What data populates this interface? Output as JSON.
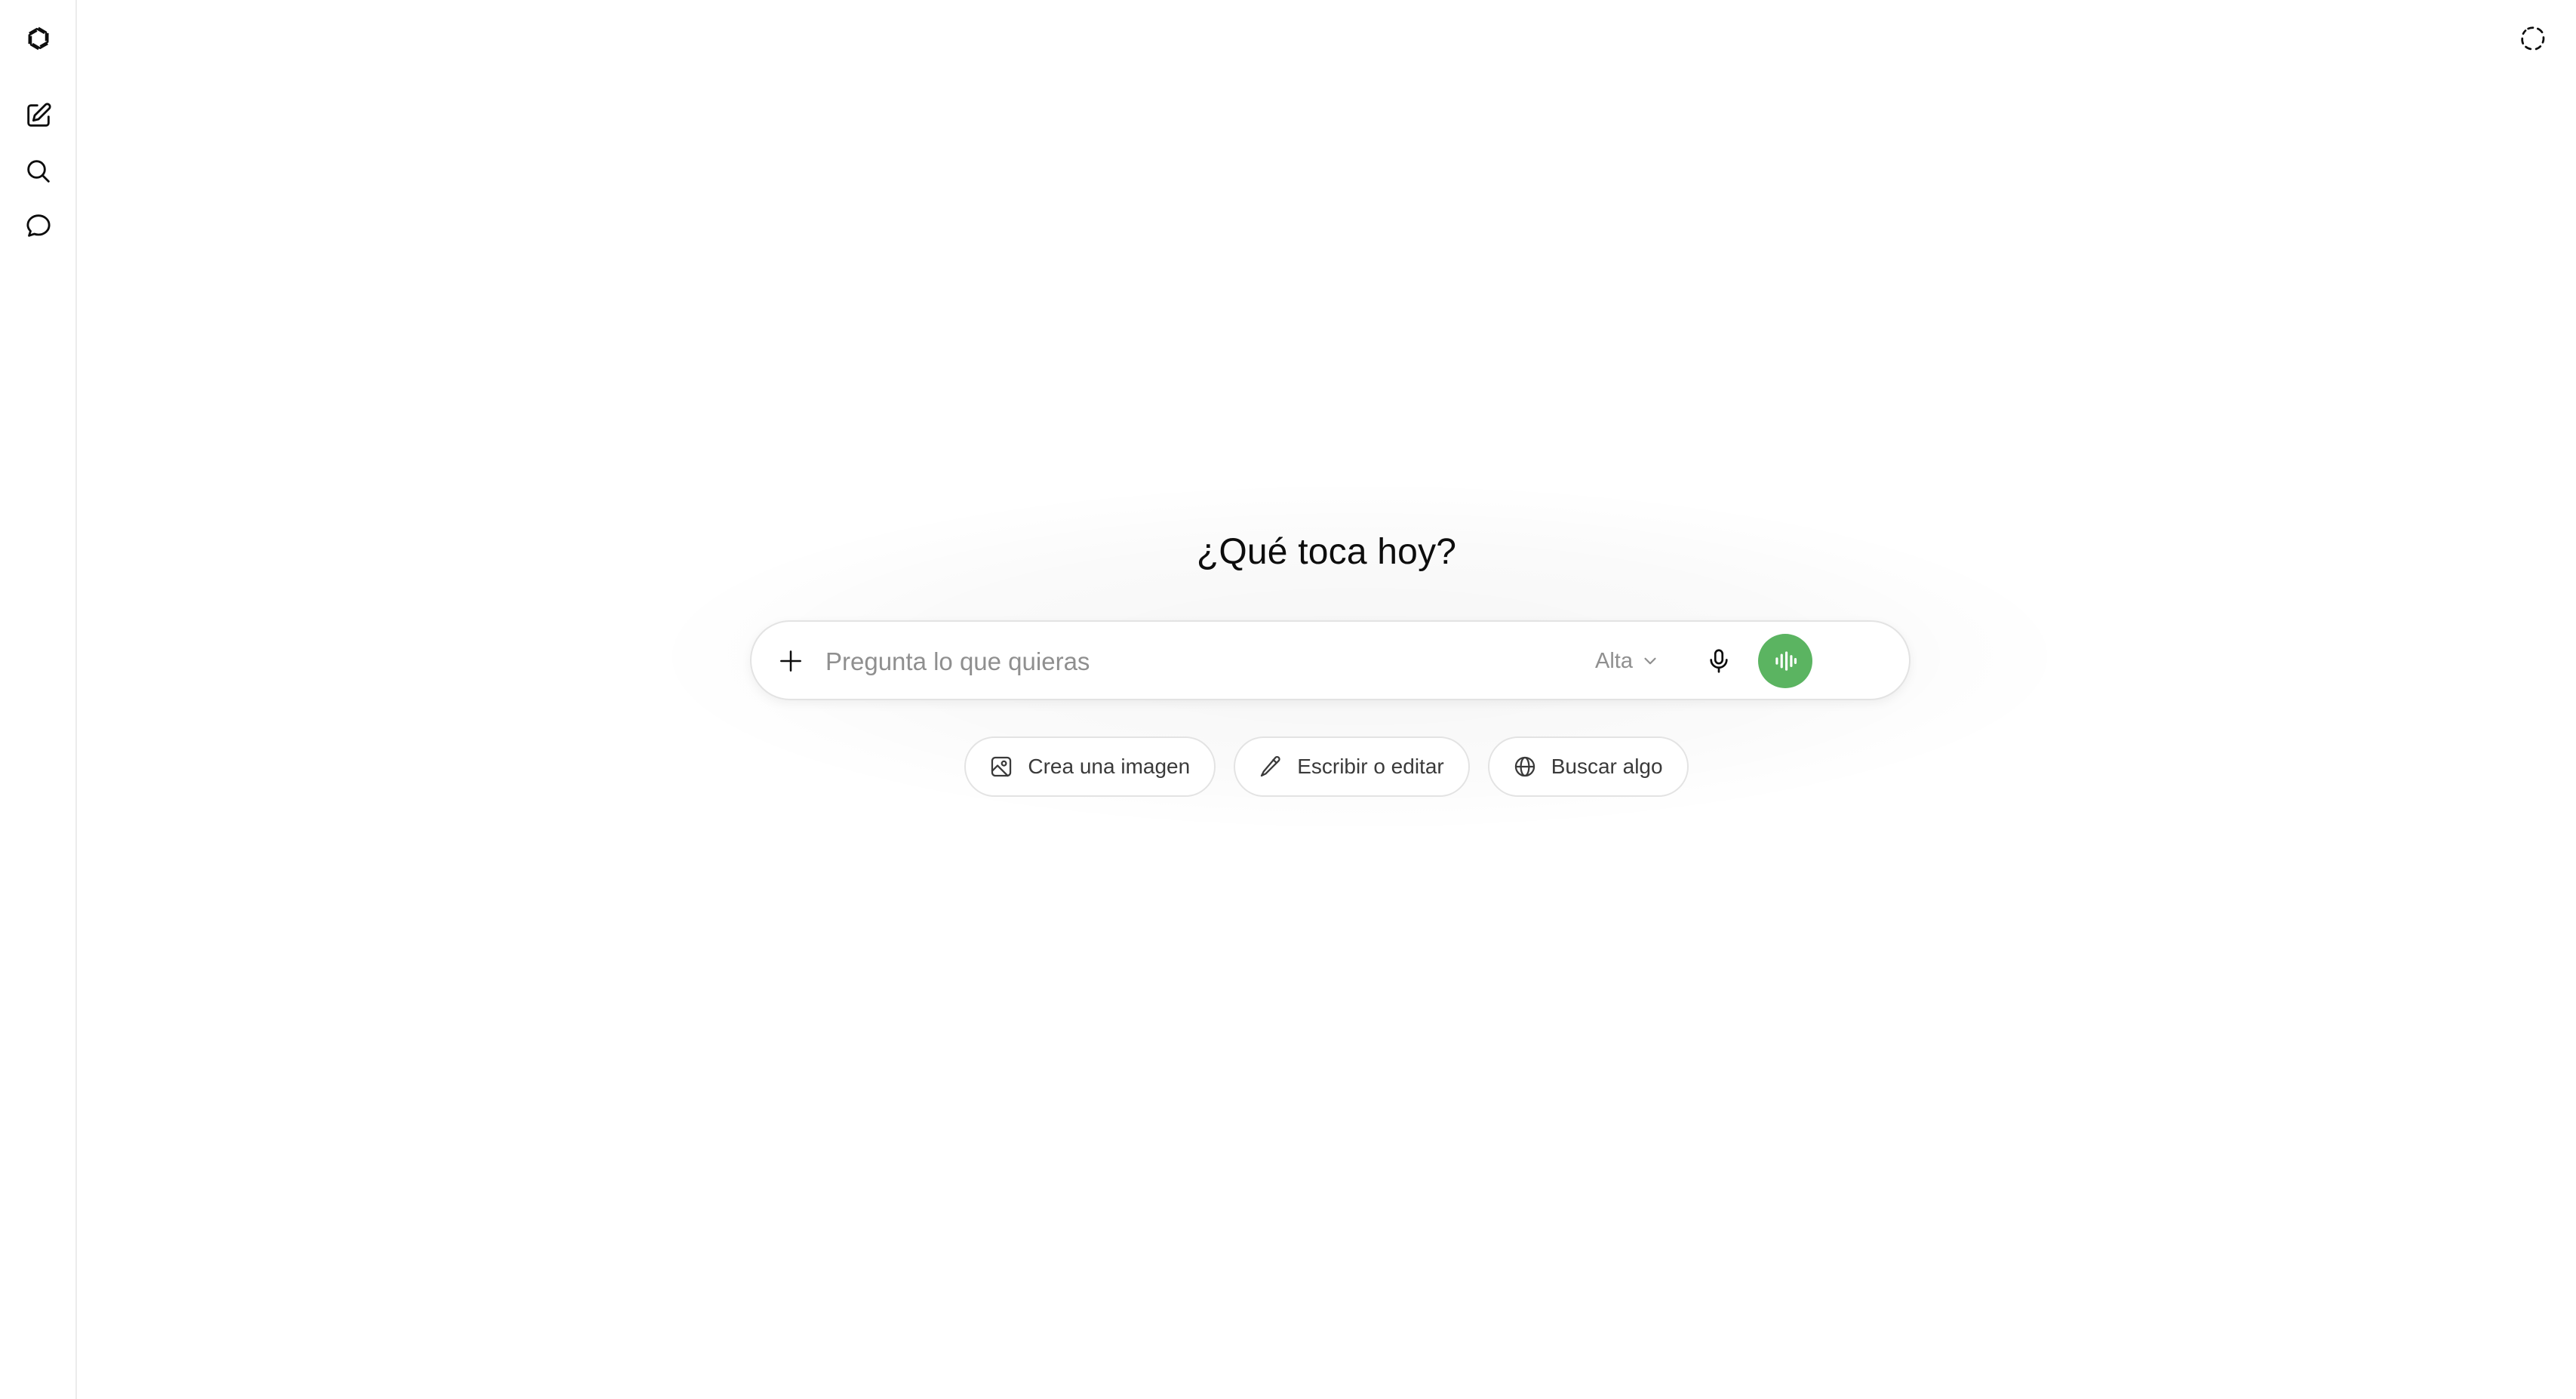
{
  "app": {
    "title": "¿Qué toca hoy?",
    "accent_color": "#5bb461"
  },
  "rail": {
    "items": [
      {
        "name": "logo",
        "icon": "openai-logo-icon"
      },
      {
        "name": "new-chat",
        "icon": "edit-square-icon"
      },
      {
        "name": "search",
        "icon": "search-icon"
      },
      {
        "name": "chats",
        "icon": "chat-bubble-icon"
      }
    ]
  },
  "header": {
    "right_icon": "temporary-chat-icon"
  },
  "composer": {
    "placeholder": "Pregunta lo que quieras",
    "value": "",
    "model_label": "Alta",
    "plus_icon": "plus-icon",
    "mic_icon": "microphone-icon",
    "voice_icon": "voice-waveform-icon"
  },
  "suggestions": [
    {
      "label": "Crea una imagen",
      "icon": "image-icon"
    },
    {
      "label": "Escribir o editar",
      "icon": "pencil-icon"
    },
    {
      "label": "Buscar algo",
      "icon": "globe-icon"
    }
  ]
}
